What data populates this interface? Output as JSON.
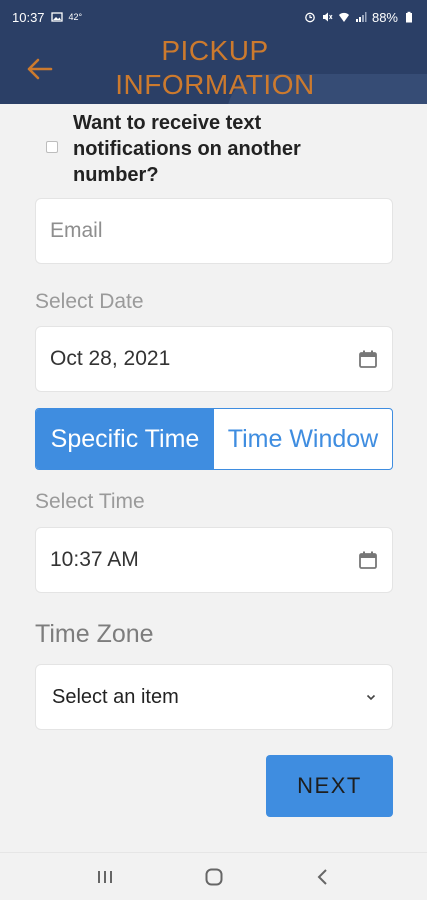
{
  "status_bar": {
    "time": "10:37",
    "temperature": "42°",
    "battery": "88%",
    "icons": [
      "image-icon",
      "alarm-icon",
      "mute-icon",
      "wifi-icon",
      "signal-icon",
      "battery-icon"
    ]
  },
  "header": {
    "title": "PICKUP INFORMATION",
    "back_icon": "arrow-left-icon",
    "title_color": "#cc7a2e",
    "background": "#2b3f66"
  },
  "form": {
    "notify_checkbox_label": "Want to receive text notifications on another number?",
    "notify_checked": false,
    "email_placeholder": "Email",
    "date_label": "Select Date",
    "date_value": "Oct 28, 2021",
    "time_mode": {
      "options": [
        "Specific Time",
        "Time Window"
      ],
      "selected": "Specific Time"
    },
    "time_label": "Select Time",
    "time_value": "10:37 AM",
    "timezone_label": "Time Zone",
    "timezone_value": "Select an item",
    "next_label": "NEXT",
    "accent_color": "#3f8de0"
  },
  "nav_bar": {
    "icons": [
      "recents-icon",
      "home-icon",
      "back-icon"
    ]
  }
}
